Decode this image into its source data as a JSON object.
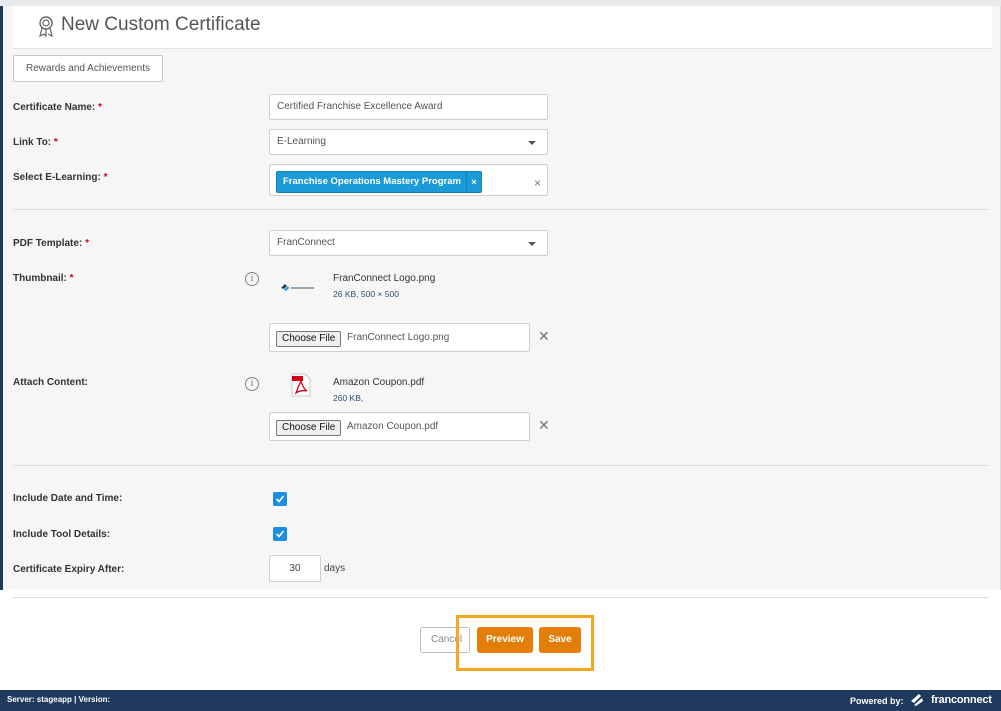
{
  "page": {
    "title": "New Custom Certificate",
    "rewards_button": "Rewards and Achievements"
  },
  "form": {
    "certificate_name": {
      "label": "Certificate Name:",
      "required": "*",
      "value": "Certified Franchise Excellence Award"
    },
    "link_to": {
      "label": "Link To:",
      "required": "*",
      "value": "E-Learning"
    },
    "select_elearning": {
      "label": "Select E-Learning:",
      "required": "*",
      "tag": "Franchise Operations Mastery Program",
      "tag_remove": "×",
      "clear": "×"
    },
    "pdf_template": {
      "label": "PDF Template:",
      "required": "*",
      "value": "FranConnect"
    },
    "thumbnail": {
      "label": "Thumbnail:",
      "required": "*",
      "file_name": "FranConnect Logo.png",
      "file_meta": "26 KB, 500 × 500",
      "choose_label": "Choose File",
      "chosen": "FranConnect Logo.png",
      "remove": "✕"
    },
    "attach_content": {
      "label": "Attach Content:",
      "file_name": "Amazon Coupon.pdf",
      "file_meta": "260 KB,",
      "choose_label": "Choose File",
      "chosen": "Amazon Coupon.pdf",
      "remove": "✕"
    },
    "include_date_time": {
      "label": "Include Date and Time:",
      "checked": true
    },
    "include_tool_details": {
      "label": "Include Tool Details:",
      "checked": true
    },
    "expiry": {
      "label": "Certificate Expiry After:",
      "value": "30",
      "unit": "days"
    },
    "info_glyph": "i"
  },
  "actions": {
    "cancel": "Cancel",
    "preview": "Preview",
    "save": "Save"
  },
  "footer": {
    "server_info": "Server: stageapp  |  Version:",
    "powered_by": "Powered by:",
    "brand": "franconnect"
  },
  "colors": {
    "accent_orange": "#e27d08",
    "highlight": "#f5a623",
    "tag_blue": "#1a9bd7",
    "footer_navy": "#1f3a5c",
    "required_red": "#d0021b"
  }
}
